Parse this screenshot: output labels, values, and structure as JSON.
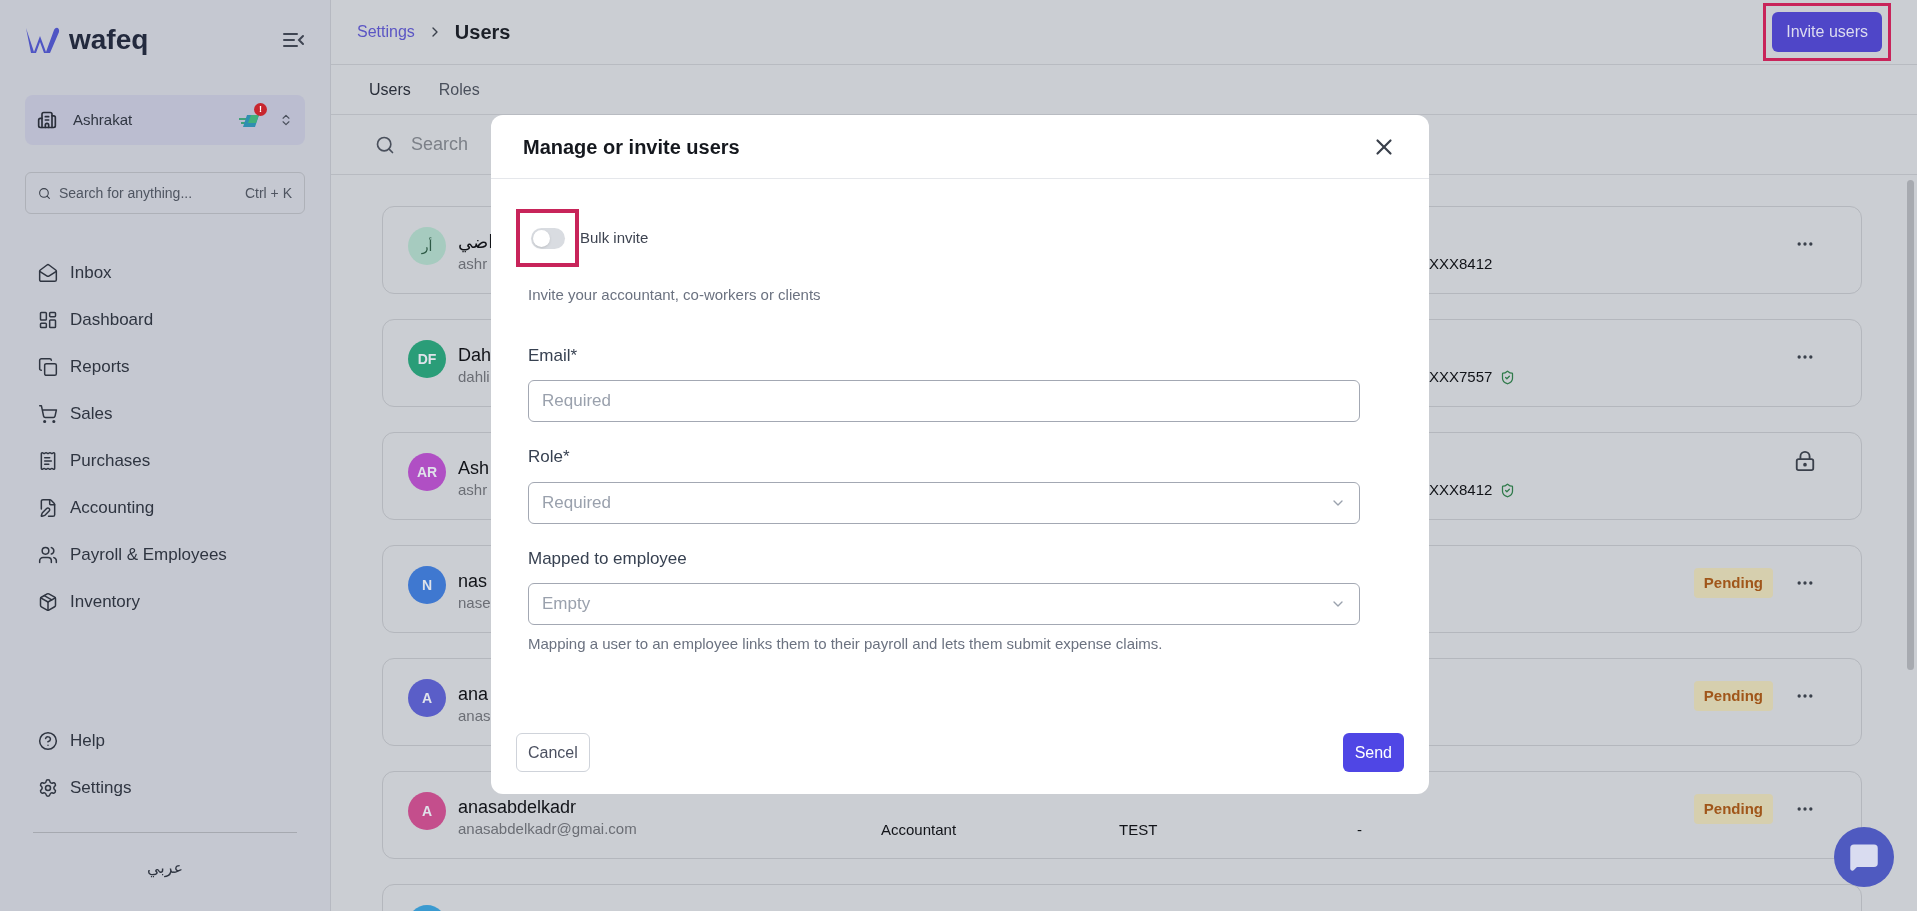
{
  "sidebar": {
    "logo": "wafeq",
    "organization": {
      "name": "Ashrakat",
      "alert_badge": "!"
    },
    "search": {
      "placeholder": "Search for anything...",
      "shortcut": "Ctrl + K"
    },
    "items": [
      {
        "label": "Inbox"
      },
      {
        "label": "Dashboard"
      },
      {
        "label": "Reports"
      },
      {
        "label": "Sales"
      },
      {
        "label": "Purchases"
      },
      {
        "label": "Accounting"
      },
      {
        "label": "Payroll & Employees"
      },
      {
        "label": "Inventory"
      }
    ],
    "footer_items": [
      {
        "label": "Help"
      },
      {
        "label": "Settings"
      }
    ],
    "language": "عربي"
  },
  "header": {
    "breadcrumb": "Settings",
    "title": "Users",
    "invite_button": {
      "label": "Invite users",
      "highlighted": true
    }
  },
  "tabs": [
    {
      "label": "Users",
      "selected": true
    },
    {
      "label": "Roles",
      "selected": false
    }
  ],
  "search": {
    "placeholder": "Search"
  },
  "users": [
    {
      "avatar": "أر",
      "color": "#a6cbbf",
      "name": "اضي",
      "email": "ashr",
      "phone": "XXX8412",
      "verified": false,
      "locked": false
    },
    {
      "avatar": "DF",
      "color": "#2a9d78",
      "name": "Dah",
      "email": "dahli",
      "phone": "XXX7557",
      "verified": true,
      "locked": false
    },
    {
      "avatar": "AR",
      "color": "#b04fc4",
      "name": "Ash",
      "email": "ashr",
      "phone": "XXX8412",
      "verified": true,
      "locked": true
    },
    {
      "avatar": "N",
      "color": "#3f78d0",
      "name": "nas",
      "email": "nase",
      "status": "Pending",
      "locked": false
    },
    {
      "avatar": "A",
      "color": "#5a5ec8",
      "name": "ana",
      "email": "anas",
      "status": "Pending",
      "locked": false
    },
    {
      "avatar": "A",
      "color": "#c44e8c",
      "name": "anasabdelkadr",
      "email": "anasabdelkadr@gmai.com",
      "role": "Accountant",
      "employee": "TEST",
      "phone": "-",
      "status": "Pending",
      "locked": false
    },
    {
      "color": "#3a9ad0",
      "locked": false
    }
  ],
  "modal": {
    "title": "Manage or invite users",
    "bulk_invite": {
      "label": "Bulk invite",
      "on": false,
      "highlighted": true
    },
    "description": "Invite your accountant, co-workers or clients",
    "fields": [
      {
        "kind": "text",
        "label": "Email*",
        "placeholder": "Required"
      },
      {
        "kind": "select",
        "label": "Role*",
        "placeholder": "Required"
      },
      {
        "kind": "select",
        "label": "Mapped to employee",
        "placeholder": "Empty"
      }
    ],
    "helper": "Mapping a user to an employee links them to their payroll and lets them submit expense claims.",
    "cancel": "Cancel",
    "send": "Send"
  }
}
